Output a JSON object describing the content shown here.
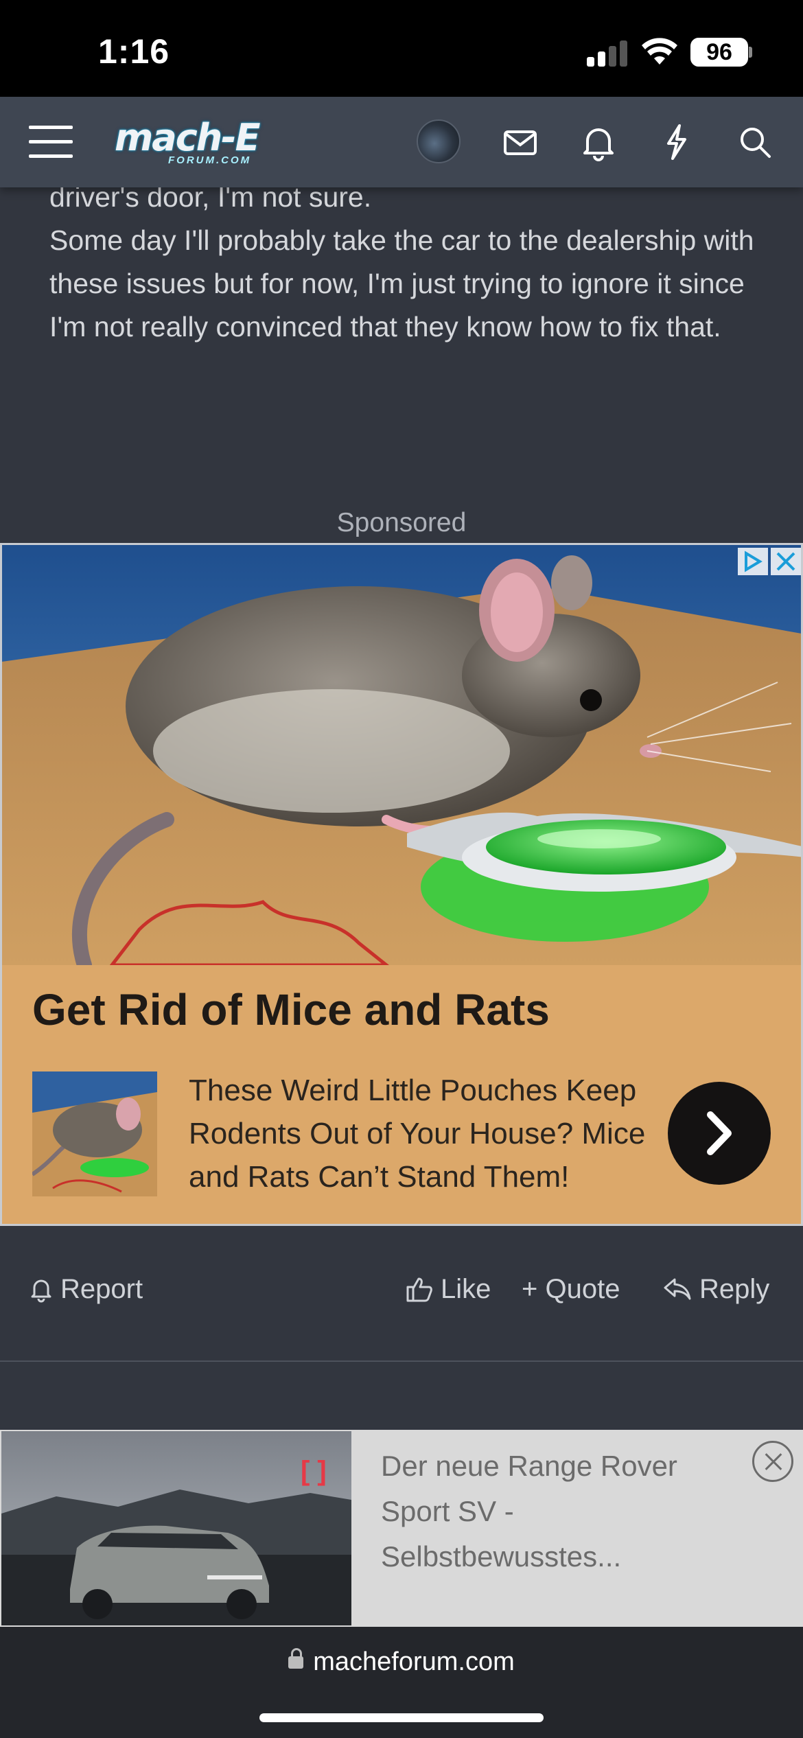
{
  "status_bar": {
    "time": "1:16",
    "battery": "96"
  },
  "nav": {
    "menu_icon": "hamburger-icon",
    "logo_text": "mach-E",
    "logo_subtext": "FORUM.COM",
    "icons": [
      "avatar",
      "envelope-icon",
      "bell-icon",
      "lightning-icon",
      "search-icon"
    ]
  },
  "post": {
    "lines": [
      "driver's door, I'm not sure.",
      "Some day I'll probably take the car to the dealership with these issues but for now, I'm just trying to ignore it since I'm not really convinced that they know how to fix that."
    ]
  },
  "sponsored_label": "Sponsored",
  "ad": {
    "title": "Get Rid of Mice and Rats",
    "description": "These Weird Little Pouches Keep Rodents Out of Your House? Mice and Rats Can’t Stand Them!",
    "colors": {
      "background": "#dca86a",
      "title": "#1f1a16"
    }
  },
  "actions": {
    "report": "Report",
    "like": "Like",
    "quote": "+ Quote",
    "reply": "Reply"
  },
  "banner": {
    "text": "Der neue Range Rover Sport SV - Selbstbewusstes..."
  },
  "url_bar": {
    "url": "macheforum.com"
  }
}
